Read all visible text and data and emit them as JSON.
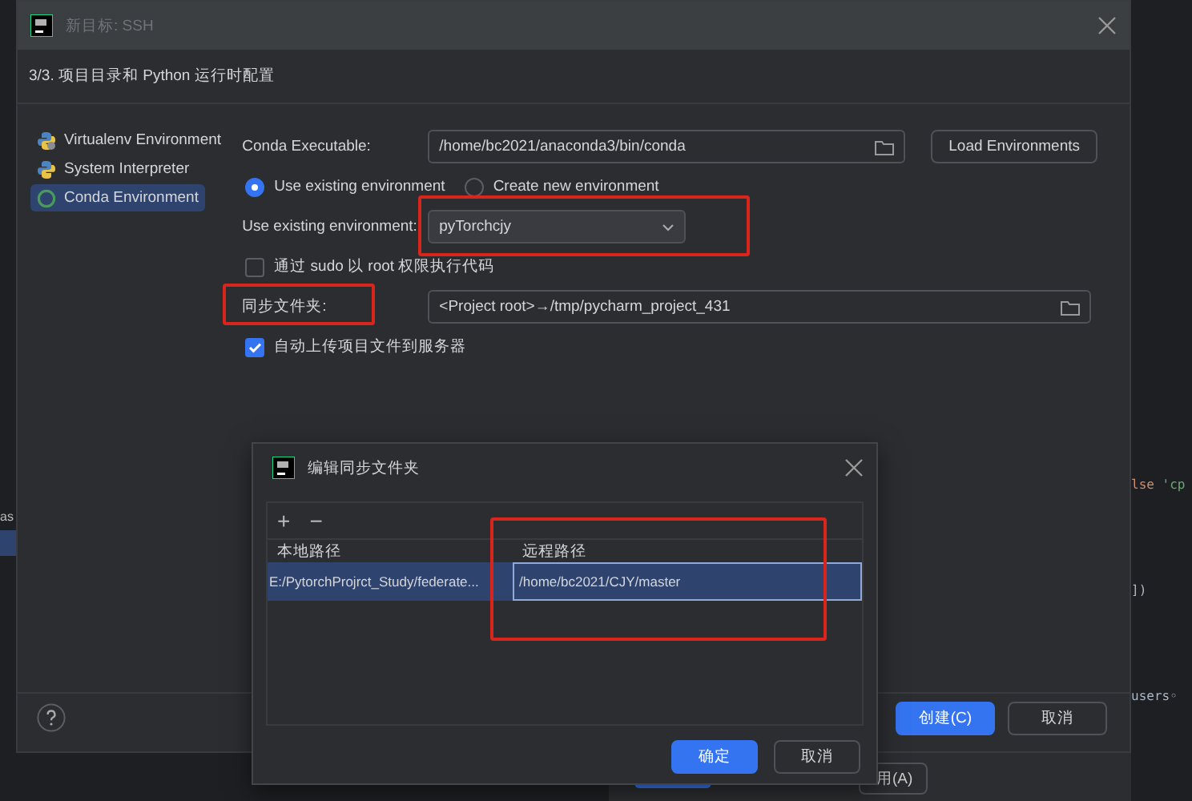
{
  "background": {
    "left_text": "as",
    "apply_button": "用(A)",
    "editor_lines": [
      {
        "tokens": [
          {
            "text": "lse",
            "kind": "keyword"
          },
          {
            "text": " 'cp",
            "kind": "string"
          }
        ]
      },
      {
        "tokens": [
          {
            "text": "])",
            "kind": "plain"
          }
        ]
      },
      {
        "tokens": [
          {
            "text": "users",
            "kind": "plain"
          },
          {
            "text": "◦",
            "kind": "plain"
          }
        ]
      }
    ]
  },
  "main_dialog": {
    "title": "新目标: SSH",
    "step": "3/3. 项目目录和 Python 运行时配置",
    "sidebar": {
      "items": [
        {
          "label": "Virtualenv Environment",
          "kind": "virtualenv",
          "selected": false
        },
        {
          "label": "System Interpreter",
          "kind": "python",
          "selected": false
        },
        {
          "label": "Conda Environment",
          "kind": "conda",
          "selected": true
        }
      ]
    },
    "conda_executable": {
      "label": "Conda Executable:",
      "value": "/home/bc2021/anaconda3/bin/conda"
    },
    "load_button": "Load Environments",
    "env_options": [
      {
        "label": "Use existing environment",
        "selected": true
      },
      {
        "label": "Create new environment",
        "selected": false
      }
    ],
    "existing_env": {
      "label": "Use existing environment:",
      "value": "pyTorchcjy",
      "highlighted": true
    },
    "sudo": {
      "label": "通过 sudo 以 root 权限执行代码",
      "checked": false
    },
    "sync_folder": {
      "label": "同步文件夹:",
      "value": "<Project root>→/tmp/pycharm_project_431",
      "highlighted": true
    },
    "auto_upload": {
      "label": "自动上传项目文件到服务器",
      "checked": true
    },
    "buttons": [
      {
        "label": "创建(C)",
        "primary": true
      },
      {
        "label": "取消",
        "primary": false
      }
    ]
  },
  "sync_dialog": {
    "title": "编辑同步文件夹",
    "toolbar": [
      "+",
      "−"
    ],
    "table": {
      "columns": [
        "本地路径",
        "远程路径"
      ],
      "remote_column_highlighted": true,
      "rows": [
        {
          "cells": [
            "E:/PytorchProjrct_Study/federate...",
            "/home/bc2021/CJY/master"
          ],
          "selected": true
        }
      ]
    },
    "buttons": [
      {
        "label": "确定",
        "primary": true
      },
      {
        "label": "取消",
        "primary": false
      }
    ]
  }
}
